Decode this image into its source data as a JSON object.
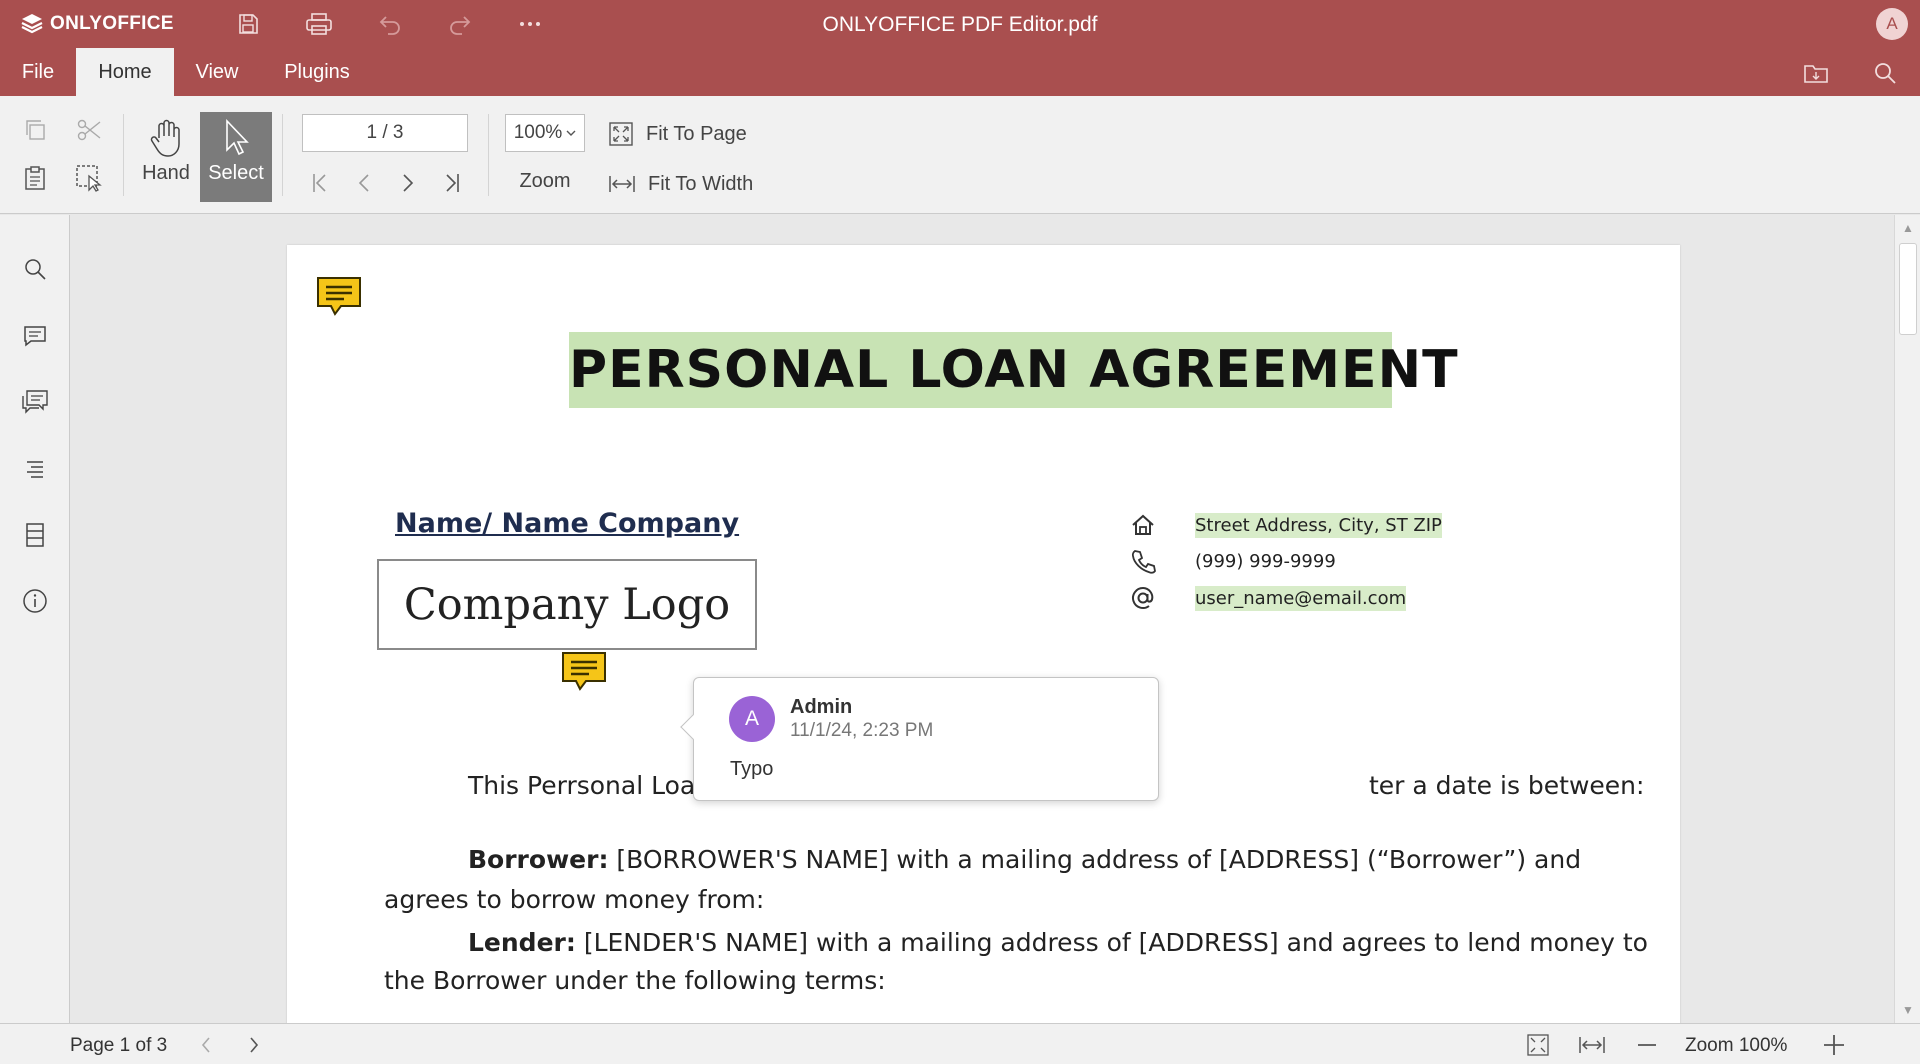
{
  "colors": {
    "header_bg": "#a94f4f",
    "ribbon_bg": "#f1f1f1",
    "active_button_bg": "#7b7b7b",
    "title_highlight": "#c8e3b4",
    "comment_icon": "#f5c518",
    "avatar_purple": "#9a63d6"
  },
  "header": {
    "brand": "ONLYOFFICE",
    "title": "ONLYOFFICE PDF Editor.pdf",
    "user_initial": "A",
    "icons": [
      "save-icon",
      "print-icon",
      "undo-icon",
      "redo-icon",
      "more-icon"
    ]
  },
  "tabs": [
    {
      "label": "File"
    },
    {
      "label": "Home",
      "active": true
    },
    {
      "label": "View"
    },
    {
      "label": "Plugins"
    }
  ],
  "ribbon": {
    "hand_label": "Hand",
    "select_label": "Select",
    "page_field": "1 / 3",
    "zoom_value": "100%",
    "zoom_label": "Zoom",
    "fit_to_page": "Fit To Page",
    "fit_to_width": "Fit To Width"
  },
  "document": {
    "title": "PERSONAL LOAN AGREEMENT",
    "company_name": "Name/ Name Company",
    "company_logo": "Company Logo",
    "address": "Street Address, City, ST ZIP",
    "phone": "(999) 999-9999",
    "email": "user_name@email.com",
    "intro_left": "This Perrsonal Loan",
    "intro_right": "ter a date is between:",
    "borrower_label": "Borrower:",
    "borrower_text": " [BORROWER'S NAME] with a mailing address of [ADDRESS] (“Borrower”) and",
    "borrower_text2": "agrees to borrow money from:",
    "lender_label": "Lender:",
    "lender_text": " [LENDER'S NAME] with a mailing address of [ADDRESS] and agrees to lend money to",
    "lender_text2": "the Borrower under the following terms:"
  },
  "comment": {
    "initial": "A",
    "author": "Admin",
    "date": "11/1/24, 2:23 PM",
    "text": "Typo"
  },
  "status": {
    "page_info": "Page 1 of 3",
    "zoom": "Zoom 100%"
  }
}
